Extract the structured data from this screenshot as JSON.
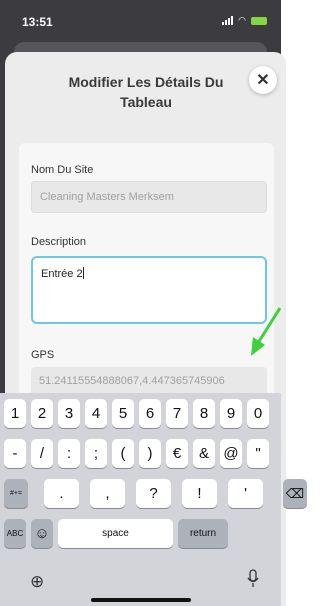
{
  "status_bar": {
    "time": "13:51"
  },
  "sheet": {
    "title": "Modifier Les Détails Du Tableau",
    "close_symbol": "✕"
  },
  "form": {
    "site_label": "Nom Du Site",
    "site_value": "Cleaning Masters Merksem",
    "description_label": "Description",
    "description_value": "Entrée 2",
    "gps_label": "GPS",
    "gps_value": "51.24115554888067,4.447365745906"
  },
  "keyboard": {
    "row1": [
      "1",
      "2",
      "3",
      "4",
      "5",
      "6",
      "7",
      "8",
      "9",
      "0"
    ],
    "row2": [
      "-",
      "/",
      ":",
      ";",
      "(",
      ")",
      "€",
      "&",
      "@",
      "\""
    ],
    "row3_left": "#+=",
    "row3": [
      ".",
      ",",
      "?",
      "!",
      "'"
    ],
    "row3_right": "⌫",
    "abc": "ABC",
    "emoji": "☺",
    "space": "space",
    "return": "return"
  },
  "colors": {
    "focus_border": "#6ec6e8",
    "annotation_arrow": "#3dd13d",
    "backdrop": "#3c3c40"
  },
  "icons": [
    "close-icon",
    "keyboard-hide-icon",
    "globe-icon",
    "microphone-icon",
    "backspace-icon",
    "emoji-icon",
    "signal-icon",
    "wifi-icon",
    "battery-icon"
  ]
}
